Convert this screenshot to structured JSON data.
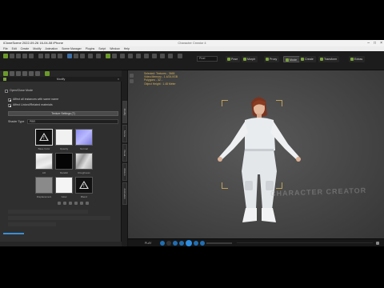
{
  "title_bar": {
    "left_text": "iCloneScene 2022-09-26 16-04-08 iPhone",
    "center_text": "Character Creator 4"
  },
  "menu": [
    "File",
    "Edit",
    "Create",
    "Modify",
    "Animation",
    "Scene Manager",
    "Plugins",
    "Script",
    "Window",
    "Help"
  ],
  "toolbar": {
    "view_select": "Pixel",
    "tabs": [
      "Pose",
      "Morph",
      "Proxy",
      "Create",
      "Mode",
      "Transform",
      "Extras"
    ],
    "selected_tab": "Mode"
  },
  "panel": {
    "title": "Modify",
    "tabs_vertical": [
      "Modify",
      "Scene",
      "Visual",
      "Motion",
      "Animation"
    ],
    "item_open_close": "Open/Close Mode",
    "item_affect_all": "Affect all instances with same name",
    "item_affect_linked": "Affect Linked/Related materials",
    "texture_button": "Texture Settings (7)",
    "shader_label": "Shader Type",
    "shader_value": "PBR",
    "textures": [
      {
        "label": "Base Color",
        "kind": "warning",
        "selected": true
      },
      {
        "label": "Opacity",
        "kind": "white"
      },
      {
        "label": "Normal",
        "kind": "normal"
      },
      {
        "label": "AO",
        "kind": "ao"
      },
      {
        "label": "Metallic",
        "kind": "black"
      },
      {
        "label": "Roughness",
        "kind": "roughness"
      },
      {
        "label": "Displacement",
        "kind": "grey"
      },
      {
        "label": "Glow",
        "kind": "white"
      },
      {
        "label": "Blend",
        "kind": "warning"
      }
    ]
  },
  "viewport": {
    "info_lines": [
      "Selected: Textures - 3665",
      "Video Memory - 1.4/24.0GB",
      "Polygons - 32...",
      "Object Height : 1.48 Meter"
    ],
    "watermark": "CHARACTER CREATOR"
  },
  "timeline": {
    "label": "PLAY"
  },
  "colors": {
    "accent_green": "#7aa33a",
    "accent_blue": "#2e8de0",
    "info_text": "#d8b25a"
  }
}
